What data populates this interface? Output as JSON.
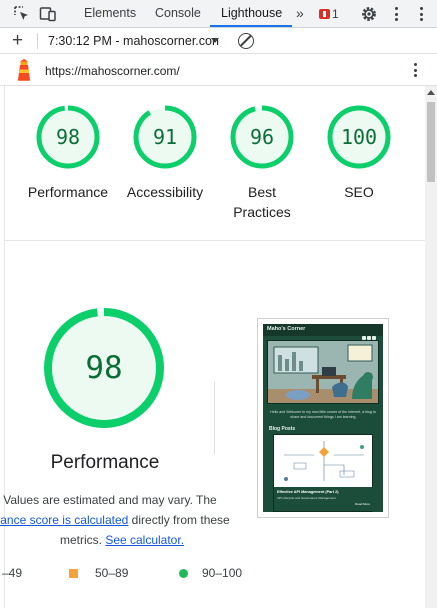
{
  "devtools": {
    "tabs": [
      {
        "label": "Elements",
        "active": false
      },
      {
        "label": "Console",
        "active": false
      },
      {
        "label": "Lighthouse",
        "active": true
      }
    ],
    "more_tabs": "»",
    "error_count": "1",
    "icons": [
      "inspect-element-icon",
      "device-toggle-icon",
      "more-tabs-icon",
      "error-badge-icon",
      "settings-gear-icon",
      "kebab-menu-icon"
    ]
  },
  "toolbar": {
    "new_report": "+",
    "report_selector": "7:30:12 PM - mahoscorner.con"
  },
  "urlbar": {
    "url": "https://mahoscorner.com/"
  },
  "categories": [
    {
      "score": 98,
      "label": "Performance"
    },
    {
      "score": 91,
      "label": "Accessibility"
    },
    {
      "score": 96,
      "label": "Best Practices"
    },
    {
      "score": 100,
      "label": "SEO"
    }
  ],
  "performance": {
    "score": 98,
    "title": "Performance",
    "note_line1": "Values are estimated and may vary. The",
    "note_link1": "mance score is calculated",
    "note_line2_rest": " directly from these",
    "note_line3": "metrics. ",
    "note_link2": "See calculator."
  },
  "legend": {
    "fail": "–49",
    "average": "50–89",
    "pass": "90–100"
  },
  "thumbnail": {
    "site_title": "Maho's Corner",
    "intro": "Hello and Welcome to my new little corner of the internet, a blog to share and document things I am learning",
    "section": "Blog Posts",
    "post_title": "Effective API Management (Part 2)",
    "post_sub": "API Lifecycle and Governance Management",
    "read_more": "Read More"
  },
  "colors": {
    "pass_green": "#0cce6b",
    "pass_text": "#0c6e37",
    "average_orange": "#f2a33a",
    "link_blue": "#1558d6",
    "tab_accent": "#1a73e8"
  }
}
